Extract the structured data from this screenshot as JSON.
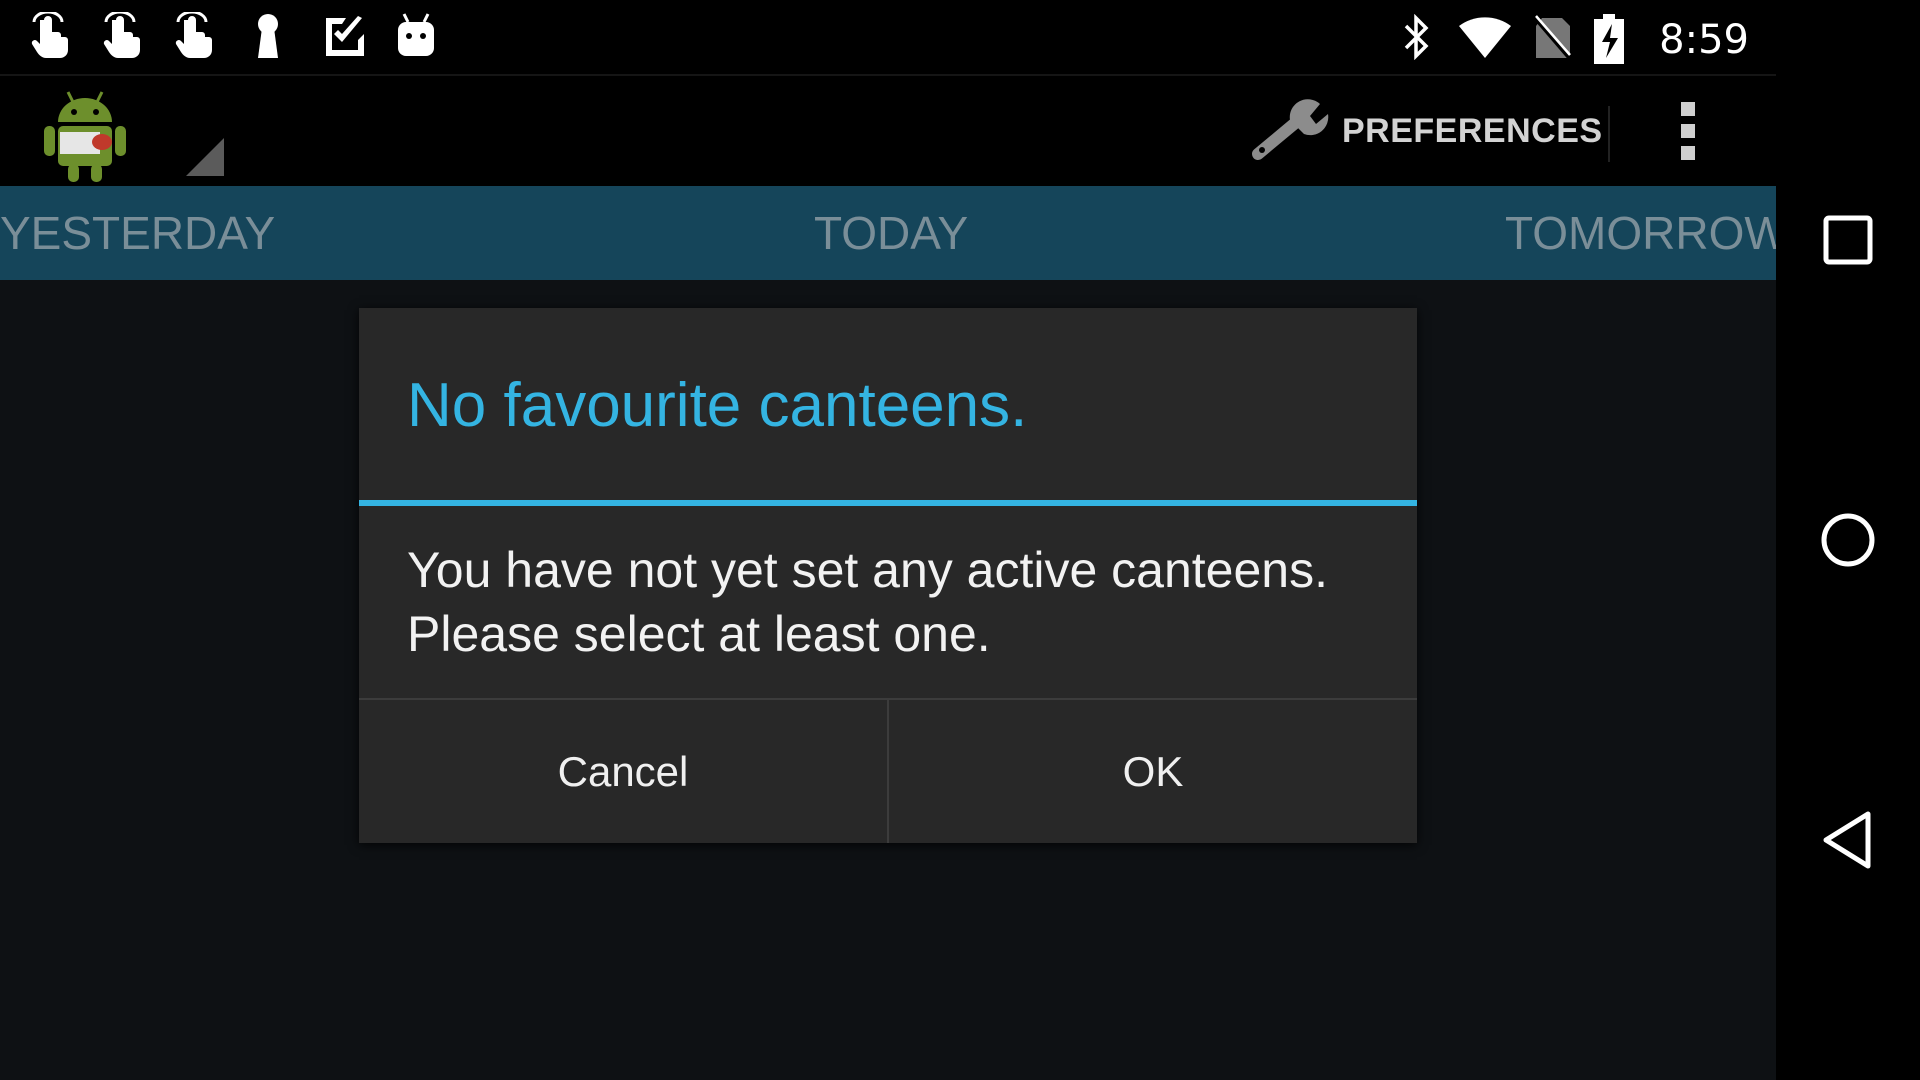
{
  "status_bar": {
    "time": "8:59",
    "notification_icons": [
      "touch-icon",
      "touch-icon",
      "touch-icon",
      "keyhole-icon",
      "checkmark-icon",
      "android-head-icon"
    ],
    "system_icons": [
      "bluetooth-icon",
      "wifi-icon",
      "no-sim-icon",
      "battery-charging-icon"
    ]
  },
  "action_bar": {
    "app_icon": "android-canteen-icon",
    "preferences_label": "PREFERENCES",
    "overflow_icon": "overflow-menu-icon"
  },
  "tabs": [
    {
      "label": "YESTERDAY"
    },
    {
      "label": "TODAY"
    },
    {
      "label": "TOMORROW"
    }
  ],
  "dialog": {
    "title": "No favourite canteens.",
    "message": "You have not yet set any active canteens. Please select at least one.",
    "cancel_label": "Cancel",
    "ok_label": "OK",
    "accent_color": "#34b4e2"
  },
  "nav_bar": {
    "buttons": [
      "recents-icon",
      "home-icon",
      "back-icon"
    ]
  },
  "colors": {
    "tab_strip": "#15455a",
    "accent": "#34b4e2",
    "dialog_bg": "#282828"
  }
}
